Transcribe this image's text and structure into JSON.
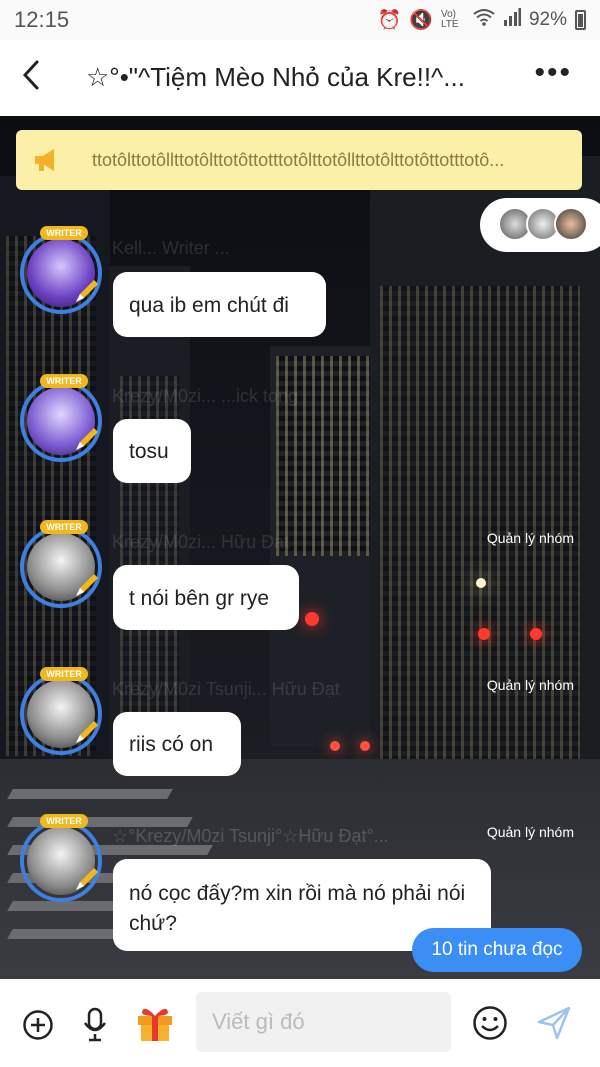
{
  "status_bar": {
    "time": "12:15",
    "network": "Vo) LTE",
    "battery": "92%"
  },
  "header": {
    "title": "☆°•\"^Tiệm Mèo Nhỏ của Kre!!^..."
  },
  "announcement": {
    "text": "ttotôlttotôllttotôlttotôttotttotôlttotôllttotôlttotôttotttotô..."
  },
  "messages": [
    {
      "faded_name": "Kell...     Writer    ...",
      "text": "qua ib em chút đi",
      "role": ""
    },
    {
      "faded_name": "Krezy/M0zi...     ...ick tong",
      "text": "tosu",
      "role": ""
    },
    {
      "faded_name": "Krezy/M0zi...  Hữu Đạt",
      "text": "t nói bên gr rye",
      "role": "Quản lý nhóm"
    },
    {
      "faded_name": "Krezy/M0zi Tsunji...  Hữu Đạt",
      "text": "riis có on",
      "role": "Quản lý nhóm"
    },
    {
      "faded_name": "☆°Krezy/M0zi Tsunji°☆Hữu Đạt°...",
      "text": "nó cọc đấy?m xin rồi mà nó phải nói chứ?",
      "role": "Quản lý nhóm"
    }
  ],
  "badge": {
    "writer": "WRITER"
  },
  "unread_button": {
    "label": "10 tin chưa đọc"
  },
  "input": {
    "placeholder": "Viết gì đó"
  },
  "colors": {
    "accent": "#3a8ef5",
    "announcement_bg": "#fcefa8",
    "avatar_ring": "#3f7fe0",
    "writer_badge": "#f1b81e"
  }
}
